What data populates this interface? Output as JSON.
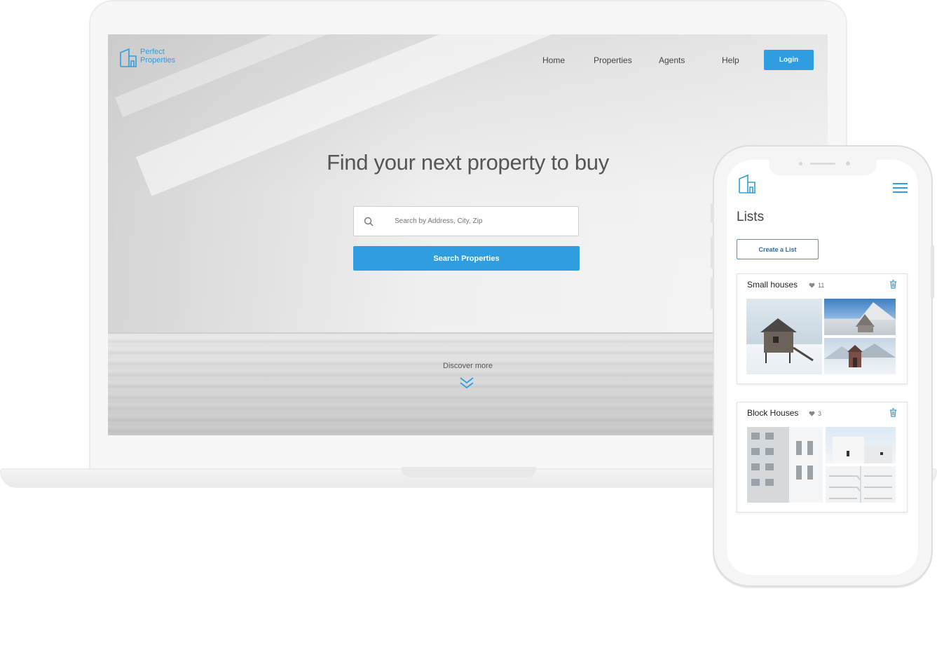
{
  "desktop": {
    "logo": {
      "line1": "Perfect",
      "line2": "Properties"
    },
    "nav": [
      "Home",
      "Properties",
      "Agents",
      "Help"
    ],
    "login_label": "Login",
    "hero_title": "Find your next property to buy",
    "search": {
      "placeholder": "Search by Address, City, Zip"
    },
    "search_button_label": "Search Properties",
    "discover_label": "Discover more"
  },
  "mobile": {
    "page_title": "Lists",
    "create_button_label": "Create a List",
    "lists": [
      {
        "name": "Small houses",
        "count": "11"
      },
      {
        "name": "Block Houses",
        "count": "3"
      }
    ]
  },
  "colors": {
    "accent": "#2f9ee0",
    "text": "#444444"
  }
}
